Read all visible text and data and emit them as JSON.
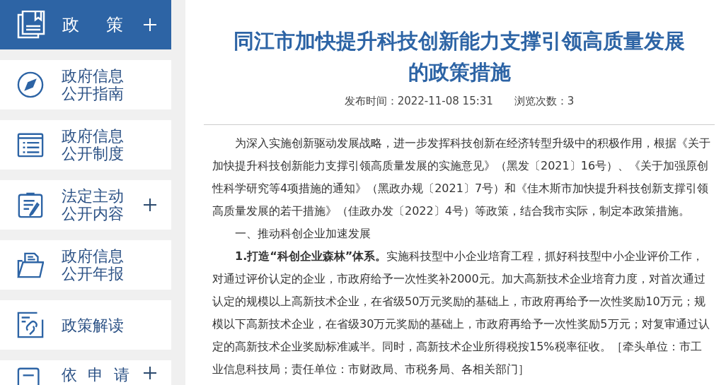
{
  "sidebar": {
    "header": {
      "label": "政 策",
      "kind": "book",
      "expandable": true
    },
    "items": [
      {
        "lines": [
          "政府信息",
          "公开指南"
        ],
        "kind": "compass",
        "expandable": false
      },
      {
        "lines": [
          "政府信息",
          "公开制度"
        ],
        "kind": "list",
        "expandable": false
      },
      {
        "lines": [
          "法定主动",
          "公开内容"
        ],
        "kind": "clipboard",
        "expandable": true
      },
      {
        "lines": [
          "政府信息",
          "公开年报"
        ],
        "kind": "folder",
        "expandable": false
      },
      {
        "lines": [
          "政策解读"
        ],
        "kind": "link",
        "expandable": false
      },
      {
        "lines": [
          "依 申 请"
        ],
        "kind": "form",
        "expandable": true
      }
    ]
  },
  "article": {
    "title": "同江市加快提升科技创新能力支撑引领高质量发展的政策措施",
    "published": "发布时间：2022-11-08 15:31",
    "views": "浏览次数：3",
    "paragraphs": [
      "为深入实施创新驱动发展战略，进一步发挥科技创新在经济转型升级中的积极作用，根据《关于加快提升科技创新能力支撑引领高质量发展的实施意见》（黑发〔2021〕16号）、《关于加强原创性科学研究等4项措施的通知》（黑政办规〔2021〕7号）和《佳木斯市加快提升科技创新支撑引领高质量发展的若干措施》（佳政办发〔2022〕4号）等政策，结合我市实际，制定本政策措施。",
      "一、推动科创企业加速发展",
      "**1.打造“科创企业森林”体系。**实施科技型中小企业培育工程，抓好科技型中小企业评价工作，对通过评价认定的企业，市政府给予一次性奖补2000元。加大高新技术企业培育力度，对首次通过认定的规模以上高新技术企业，在省级50万元奖励的基础上，市政府再给予一次性奖励10万元；规模以下高新技术企业，在省级30万元奖励的基础上，市政府再给予一次性奖励5万元；对复审通过认定的高新技术企业奖励标准减半。同时，高新技术企业所得税按15%税率征收。［牵头单位：市工业信息科技局；责任单位：市财政局、市税务局、各相关部门］"
    ]
  }
}
